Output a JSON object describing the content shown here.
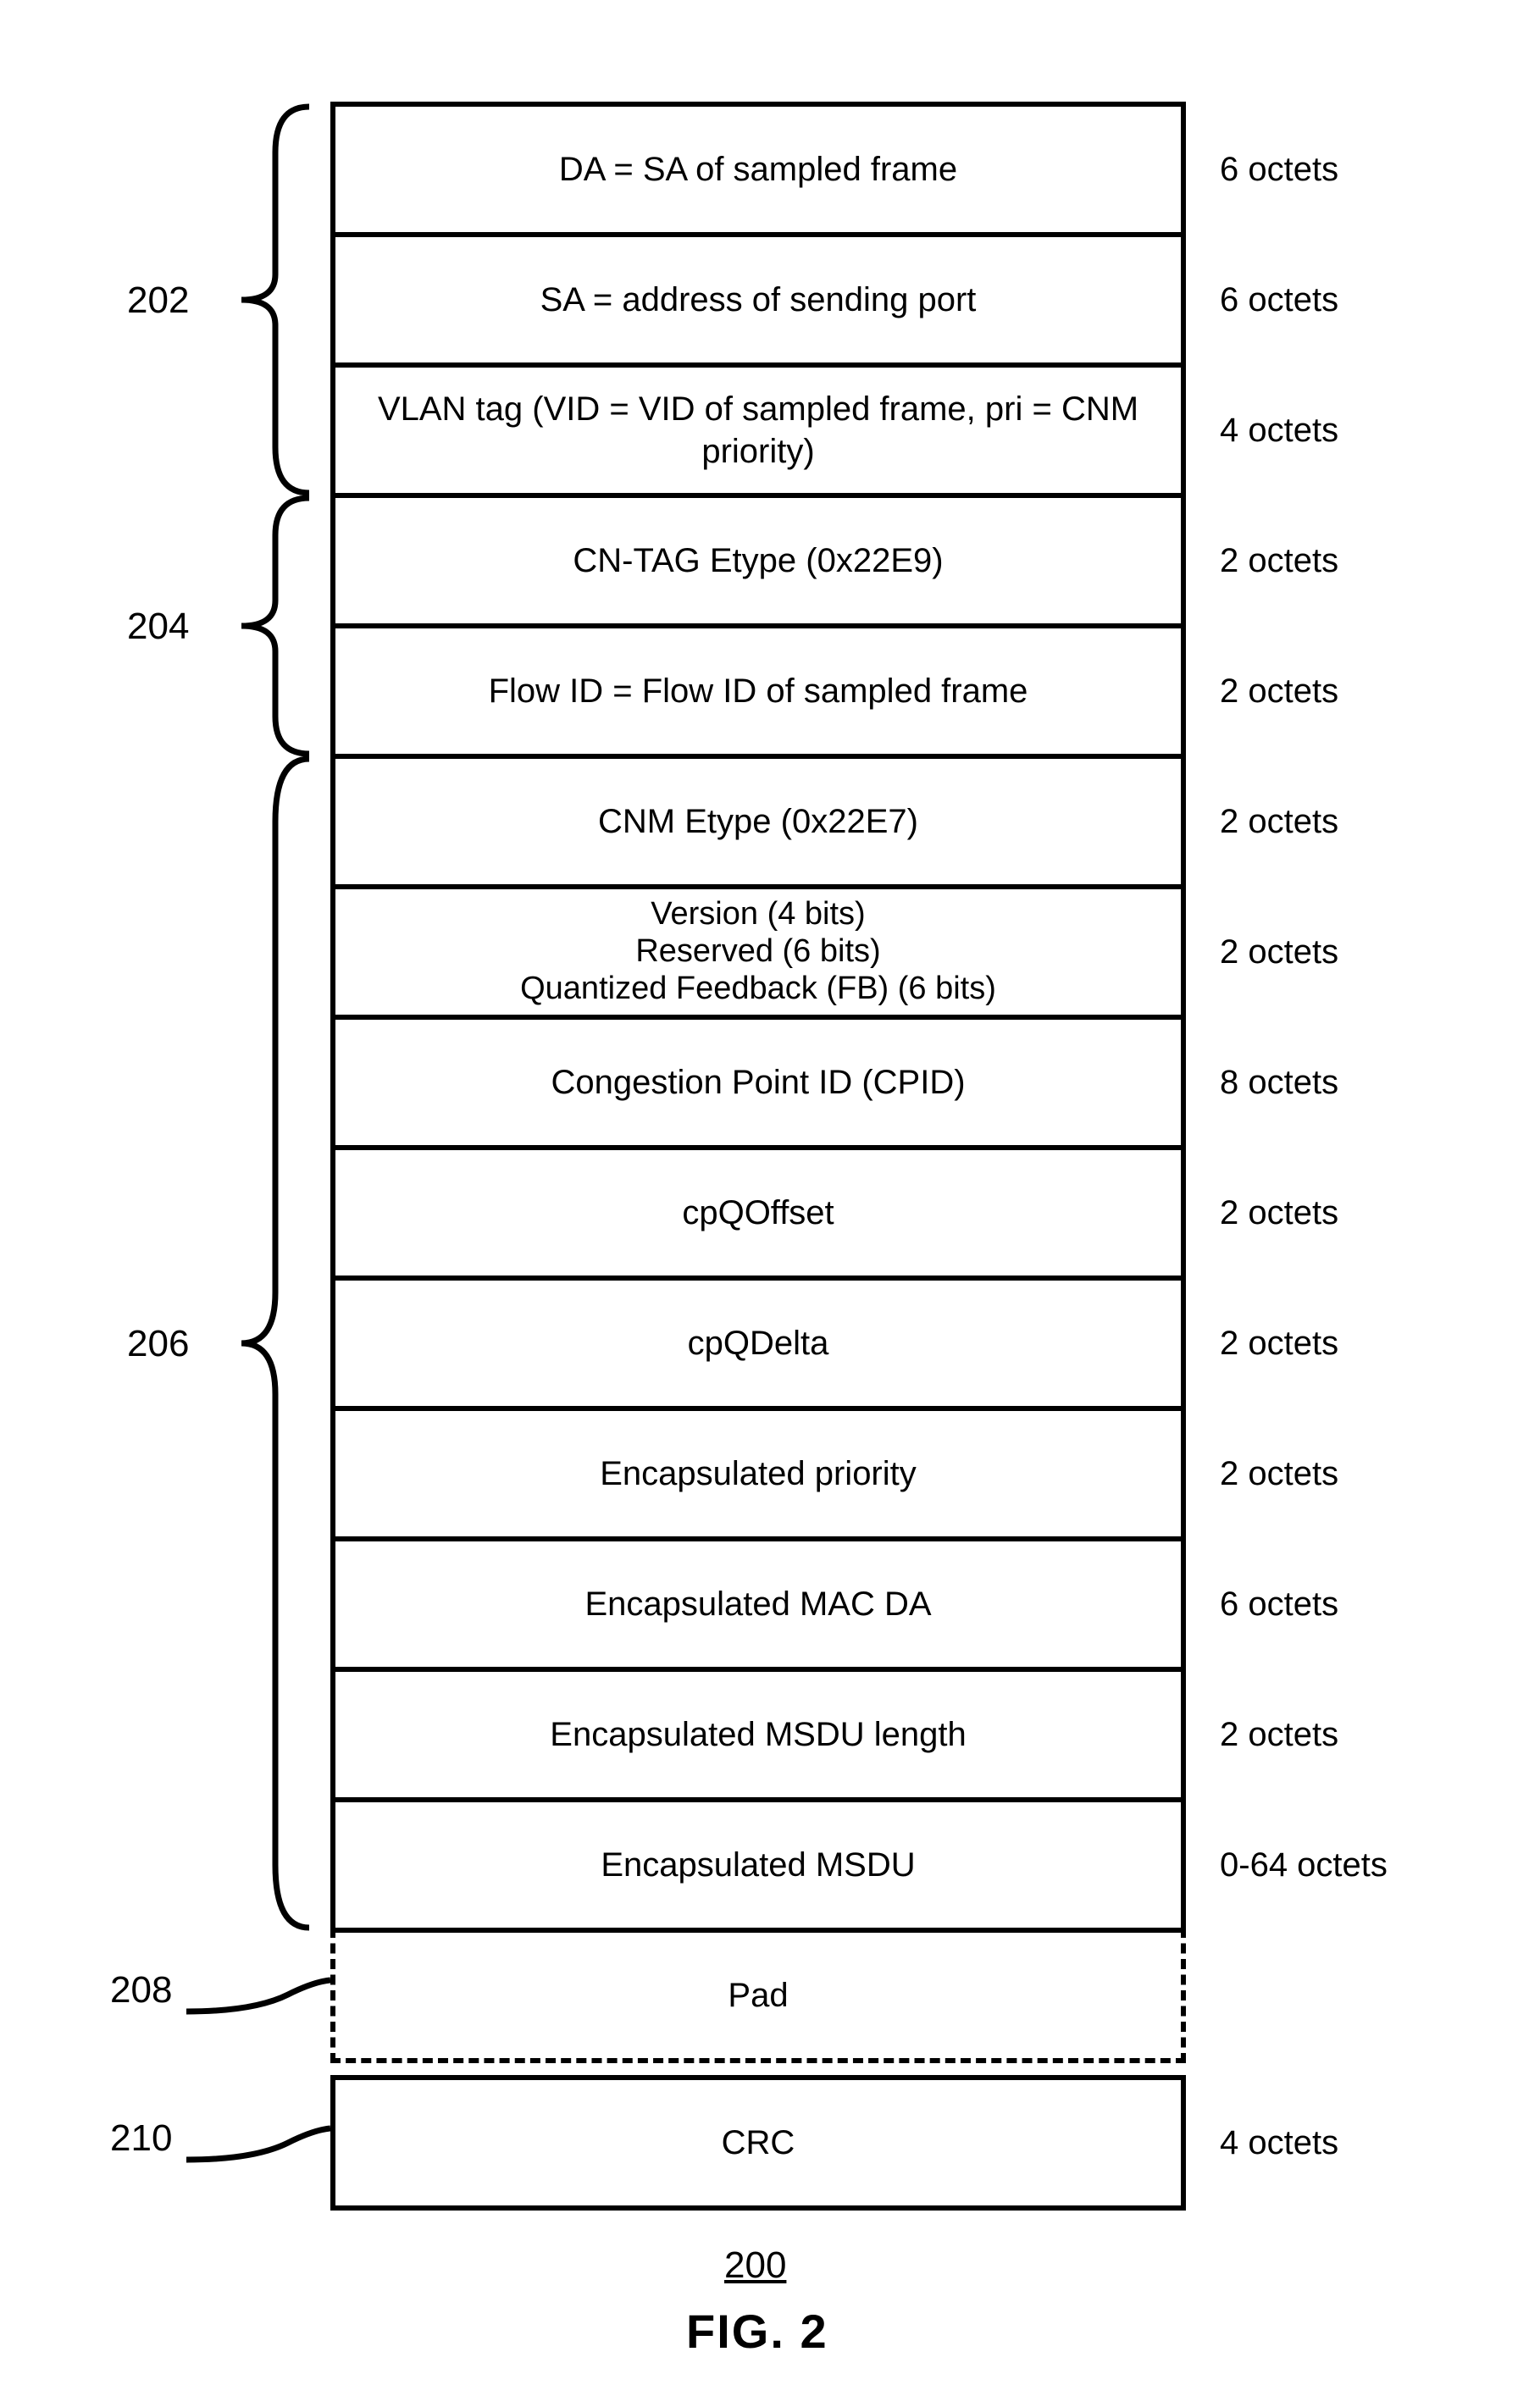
{
  "figure": {
    "number": "200",
    "caption": "FIG. 2"
  },
  "groups": {
    "g202": "202",
    "g204": "204",
    "g206": "206",
    "g208": "208",
    "g210": "210"
  },
  "rows": [
    {
      "id": "da",
      "text": "DA = SA of sampled frame",
      "size": "6 octets"
    },
    {
      "id": "sa",
      "text": "SA = address of sending port",
      "size": "6 octets"
    },
    {
      "id": "vlan",
      "text": "VLAN tag (VID = VID of sampled frame, pri = CNM priority)",
      "size": "4 octets"
    },
    {
      "id": "cntag",
      "text": "CN-TAG Etype (0x22E9)",
      "size": "2 octets"
    },
    {
      "id": "flowid",
      "text": "Flow ID = Flow ID of sampled frame",
      "size": "2 octets"
    },
    {
      "id": "cnmetype",
      "text": "CNM Etype (0x22E7)",
      "size": "2 octets"
    },
    {
      "id": "vrf",
      "text": "Version (4 bits)\nReserved (6 bits)\nQuantized Feedback (FB) (6 bits)",
      "size": "2 octets"
    },
    {
      "id": "cpid",
      "text": "Congestion Point ID (CPID)",
      "size": "8 octets"
    },
    {
      "id": "cpqoff",
      "text": "cpQOffset",
      "size": "2 octets"
    },
    {
      "id": "cpqdel",
      "text": "cpQDelta",
      "size": "2 octets"
    },
    {
      "id": "encpri",
      "text": "Encapsulated priority",
      "size": "2 octets"
    },
    {
      "id": "encmac",
      "text": "Encapsulated MAC DA",
      "size": "6 octets"
    },
    {
      "id": "encmsdul",
      "text": "Encapsulated MSDU length",
      "size": "2 octets"
    },
    {
      "id": "encmsdu",
      "text": "Encapsulated MSDU",
      "size": "0-64 octets"
    },
    {
      "id": "pad",
      "text": "Pad",
      "size": ""
    },
    {
      "id": "crc",
      "text": "CRC",
      "size": "4 octets"
    }
  ]
}
